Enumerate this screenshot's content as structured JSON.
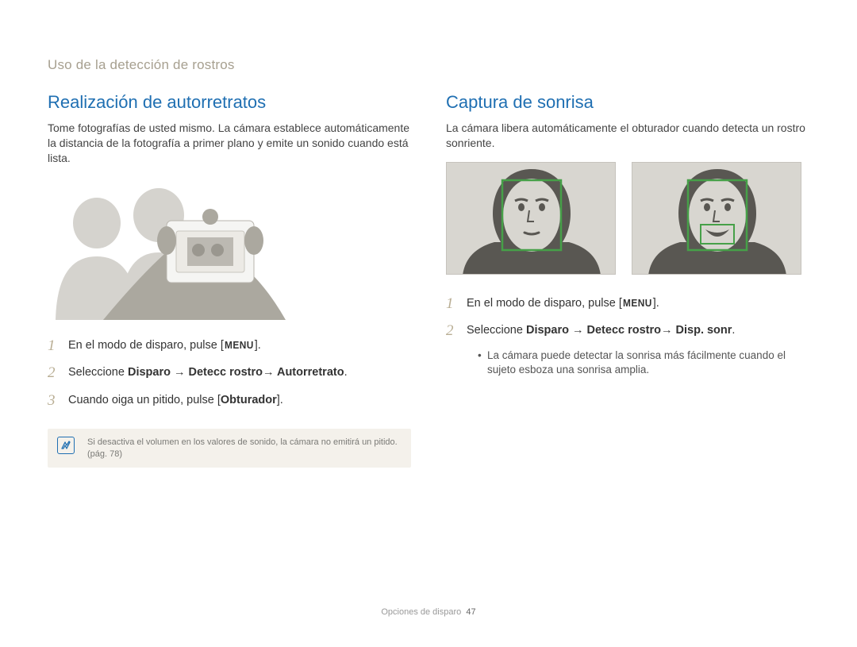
{
  "breadcrumb": "Uso de la detección de rostros",
  "left": {
    "title": "Realización de autorretratos",
    "intro": "Tome fotografías de usted mismo. La cámara establece automáticamente la distancia de la fotografía a primer plano y emite un sonido cuando está lista.",
    "steps": [
      {
        "num": "1",
        "pre": "En el modo de disparo, pulse [",
        "menu": "MENU",
        "post": "]."
      },
      {
        "num": "2",
        "pre": "Seleccione ",
        "bold": "Disparo → Detecc rostro→ Autorretrato",
        "post": "."
      },
      {
        "num": "3",
        "pre": "Cuando oiga un pitido, pulse [",
        "bold": "Obturador",
        "post": "]."
      }
    ],
    "note": {
      "text": "Si desactiva el volumen en los valores de sonido, la cámara no emitirá un pitido. (pág. 78)"
    }
  },
  "right": {
    "title": "Captura de sonrisa",
    "intro": "La cámara libera automáticamente el obturador cuando detecta un rostro sonriente.",
    "steps": [
      {
        "num": "1",
        "pre": "En el modo de disparo, pulse [",
        "menu": "MENU",
        "post": "]."
      },
      {
        "num": "2",
        "pre": "Seleccione ",
        "bold": "Disparo → Detecc rostro→ Disp. sonr",
        "post": "."
      }
    ],
    "bullet": "La cámara puede detectar la sonrisa más fácilmente cuando el sujeto esboza una sonrisa amplia."
  },
  "footer": {
    "label": "Opciones de disparo",
    "page": "47"
  }
}
